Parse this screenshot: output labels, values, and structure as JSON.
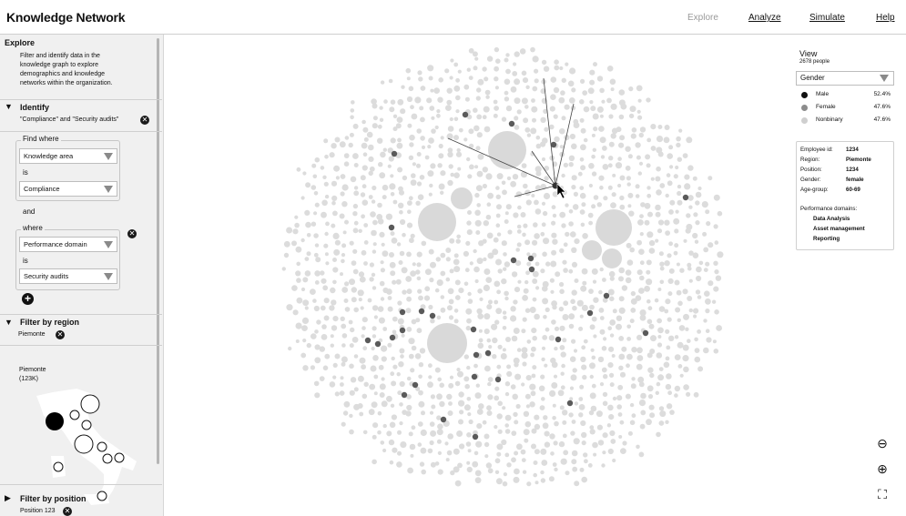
{
  "header": {
    "title": "Knowledge Network",
    "nav": [
      {
        "label": "Explore",
        "current": true
      },
      {
        "label": "Analyze",
        "current": false
      },
      {
        "label": "Simulate",
        "current": false
      },
      {
        "label": "Help",
        "current": false
      }
    ]
  },
  "sidebar": {
    "explore": {
      "title": "Explore",
      "description": [
        "Filter and identify data in the",
        "knowledge graph to explore",
        "demographics and knowledge",
        "networks within the organization."
      ]
    },
    "identify": {
      "title": "Identify",
      "summary": "\"Compliance\" and \"Security audits\"",
      "group_label": "Find where",
      "field1": "Knowledge area",
      "is1": "is",
      "value1": "Compliance",
      "and": "and",
      "where": "where",
      "field2": "Performance domain",
      "is2": "is",
      "value2": "Security audits",
      "remove_glyph": "✕",
      "add_glyph": "+"
    },
    "region": {
      "title": "Filter by region",
      "chip": "Piemonte",
      "map_label": "Piemonte",
      "map_count": "(123K)"
    },
    "position": {
      "title": "Filter by position",
      "chip": "Position 123"
    }
  },
  "view": {
    "title": "View",
    "subtitle": "2678 people",
    "select": "Gender",
    "legend": [
      {
        "label": "Male",
        "value": "52.4%",
        "color": "#111111"
      },
      {
        "label": "Female",
        "value": "47.6%",
        "color": "#8c8c8c"
      },
      {
        "label": "Nonbinary",
        "value": "47.6%",
        "color": "#cfcfcf"
      }
    ]
  },
  "employee": {
    "rows": [
      {
        "key": "Employee id:",
        "value": "1234"
      },
      {
        "key": "Region:",
        "value": "Piemonte"
      },
      {
        "key": "Position:",
        "value": "1234"
      },
      {
        "key": "Gender:",
        "value": "female"
      },
      {
        "key": "Age-group:",
        "value": "60-69"
      }
    ],
    "domains_title": "Performance domains:",
    "domains": [
      "Data Analysis",
      "Asset management",
      "Reporting"
    ]
  },
  "zoom": {
    "zoom_out_glyph": "⊖",
    "zoom_in_glyph": "⊕",
    "fullscreen_glyph": "⛶"
  },
  "colors": {
    "node_default": "#dcdcdc",
    "node_highlight": "#5a5a5a",
    "cluster": "#d9d9d9",
    "map_selected": "#000000"
  }
}
